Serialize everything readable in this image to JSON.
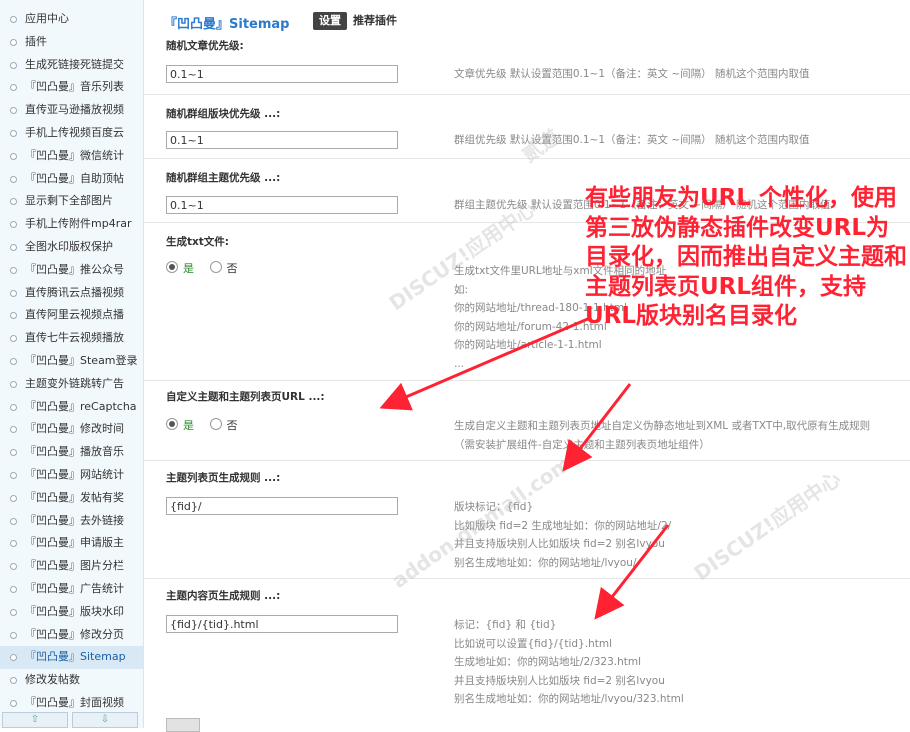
{
  "sidebar": {
    "items": [
      {
        "label": "应用中心"
      },
      {
        "label": "插件"
      },
      {
        "label": "生成死链接死链提交"
      },
      {
        "label": "『凹凸曼』音乐列表"
      },
      {
        "label": "直传亚马逊播放视频"
      },
      {
        "label": "手机上传视频百度云"
      },
      {
        "label": "『凹凸曼』微信统计"
      },
      {
        "label": "『凹凸曼』自助顶帖"
      },
      {
        "label": "显示剩下全部图片"
      },
      {
        "label": "手机上传附件mp4rar"
      },
      {
        "label": "全图水印版权保护"
      },
      {
        "label": "『凹凸曼』推公众号"
      },
      {
        "label": "直传腾讯云点播视频"
      },
      {
        "label": "直传阿里云视频点播"
      },
      {
        "label": "直传七牛云视频播放"
      },
      {
        "label": "『凹凸曼』Steam登录"
      },
      {
        "label": "主题变外链跳转广告"
      },
      {
        "label": "『凹凸曼』reCaptcha"
      },
      {
        "label": "『凹凸曼』修改时间"
      },
      {
        "label": "『凹凸曼』播放音乐"
      },
      {
        "label": "『凹凸曼』网站统计"
      },
      {
        "label": "『凹凸曼』发帖有奖"
      },
      {
        "label": "『凹凸曼』去外链接"
      },
      {
        "label": "『凹凸曼』申请版主"
      },
      {
        "label": "『凹凸曼』图片分栏"
      },
      {
        "label": "『凹凸曼』广告统计"
      },
      {
        "label": "『凹凸曼』版块水印"
      },
      {
        "label": "『凹凸曼』修改分页"
      },
      {
        "label": "『凹凸曼』Sitemap",
        "active": true
      },
      {
        "label": "修改发帖数"
      },
      {
        "label": "『凹凸曼』封面视频"
      }
    ],
    "scroll_up": "⇧",
    "scroll_down": "⇩"
  },
  "header": {
    "title": "『凹凸曼』Sitemap",
    "tab_settings": "设置",
    "tab_recommended": "推荐插件"
  },
  "rows": {
    "r0": {
      "label": "随机文章优先级:",
      "value": "0.1~1",
      "desc": "文章优先级 默认设置范围0.1~1（备注：英文 ~间隔） 随机这个范围内取值"
    },
    "r1": {
      "label": "随机群组版块优先级 ...:",
      "value": "0.1~1",
      "desc": "群组优先级 默认设置范围0.1~1（备注：英文 ~间隔） 随机这个范围内取值"
    },
    "r2": {
      "label": "随机群组主题优先级 ...:",
      "value": "0.1~1",
      "desc": "群组主题优先级 默认设置范围0.1~1（备注：英文 ~间隔） 随机这个范围内取值"
    },
    "r3": {
      "label": "生成txt文件:",
      "yes": "是",
      "no": "否",
      "desc": [
        "生成txt文件里URL地址与xml文件相同的地址",
        "如:",
        "你的网站地址/thread-180-1-1.html",
        "你的网站地址/forum-42-1.html",
        "你的网站地址/article-1-1.html",
        "..."
      ]
    },
    "r4": {
      "label": "自定义主题和主题列表页URL ...:",
      "yes": "是",
      "no": "否",
      "desc": [
        "生成自定义主题和主题列表页地址自定义伪静态地址到XML 或者TXT中,取代原有生成规则",
        "（需安装扩展组件-自定义主题和主题列表页地址组件）"
      ]
    },
    "r5": {
      "label": "主题列表页生成规则 ...:",
      "value": "{fid}/",
      "desc": [
        "版块标记：{fid}",
        "比如版块 fid=2 生成地址如：你的网站地址/2/",
        "并且支持版块别人比如版块 fid=2 别名lvyou",
        "别名生成地址如：你的网站地址/lvyou/"
      ]
    },
    "r6": {
      "label": "主题内容页生成规则 ...:",
      "value": "{fid}/{tid}.html",
      "desc": [
        "标记：{fid} 和 {tid}",
        "比如说可以设置{fid}/{tid}.html",
        "生成地址如：你的网站地址/2/323.html",
        "并且支持版块别人比如版块 fid=2 别名lvyou",
        "别名生成地址如：你的网站地址/lvyou/323.html"
      ]
    }
  },
  "annotation": "有些朋友为URL 个性化，使用第三放伪静态插件改变URL为目录化，因而推出自定义主题和主题列表页URL组件，支持URL版块别名目录化",
  "watermark": {
    "brand": "DISCUZ!应用中心",
    "domain": "addon.dismall.com",
    "mark": "贰道"
  },
  "colors": {
    "accent": "#2b7acb",
    "annotation": "#ff2233",
    "sidebar_bg": "#f2f9fd"
  }
}
